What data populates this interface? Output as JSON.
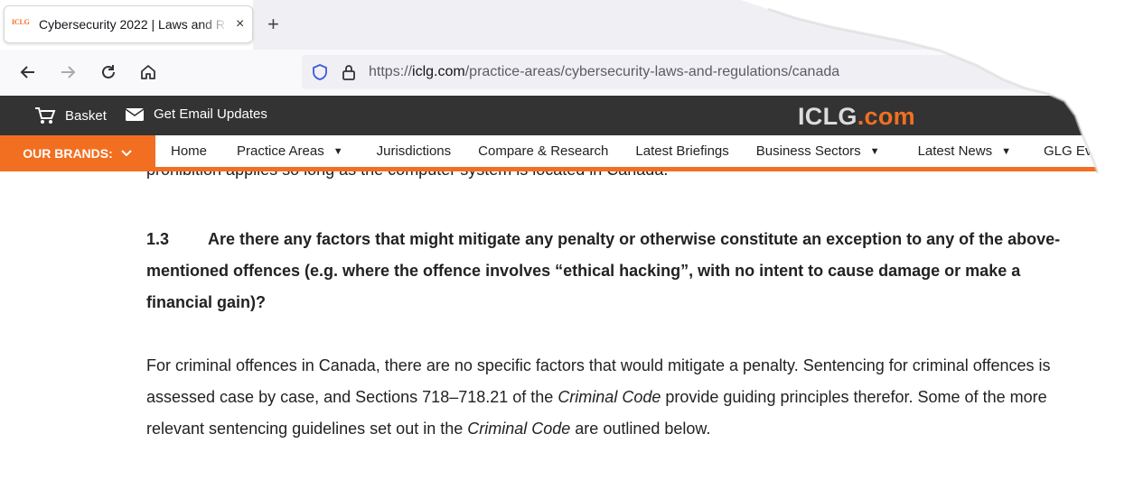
{
  "browser": {
    "tab": {
      "favicon_text": "ICLG",
      "title": "Cybersecurity 2022 | Laws and R",
      "close": "×"
    },
    "new_tab": "+",
    "url": {
      "scheme": "https://",
      "domain": "iclg.com",
      "path": "/practice-areas/cybersecurity-laws-and-regulations/canada"
    }
  },
  "header": {
    "basket_label": "Basket",
    "email_label": "Get Email Updates",
    "logo_main": "ICLG",
    "logo_accent": ".com"
  },
  "nav": {
    "brands_label": "OUR BRANDS:",
    "items": [
      {
        "label": "Home",
        "dropdown": false
      },
      {
        "label": "Practice Areas",
        "dropdown": true
      },
      {
        "label": "Jurisdictions",
        "dropdown": false
      },
      {
        "label": "Compare & Research",
        "dropdown": false
      },
      {
        "label": "Latest Briefings",
        "dropdown": false
      },
      {
        "label": "Business Sectors",
        "dropdown": true
      },
      {
        "label": "Latest News",
        "dropdown": true
      },
      {
        "label": "GLG Events",
        "dropdown": false
      }
    ]
  },
  "content": {
    "cut_line": "prohibition applies so long as the computer system is located in Canada.",
    "question_number": "1.3",
    "question_text": "Are there any factors that might mitigate any penalty or otherwise constitute an exception to any of the above-mentioned offences (e.g. where the offence involves “ethical hacking”, with no intent to cause damage or make a financial gain)?",
    "answer_part1": "For criminal offences in Canada, there are no specific factors that would mitigate a penalty.  Sentencing for criminal offences is assessed case by case, and Sections 718–718.21 of the ",
    "answer_em1": "Criminal Code",
    "answer_part2": " provide guiding principles therefor.  Some of the more relevant sentencing guidelines set out in the ",
    "answer_em2": "Criminal Code",
    "answer_part3": " are outlined below."
  },
  "colors": {
    "accent": "#f26f21",
    "header_bg": "#333333"
  }
}
